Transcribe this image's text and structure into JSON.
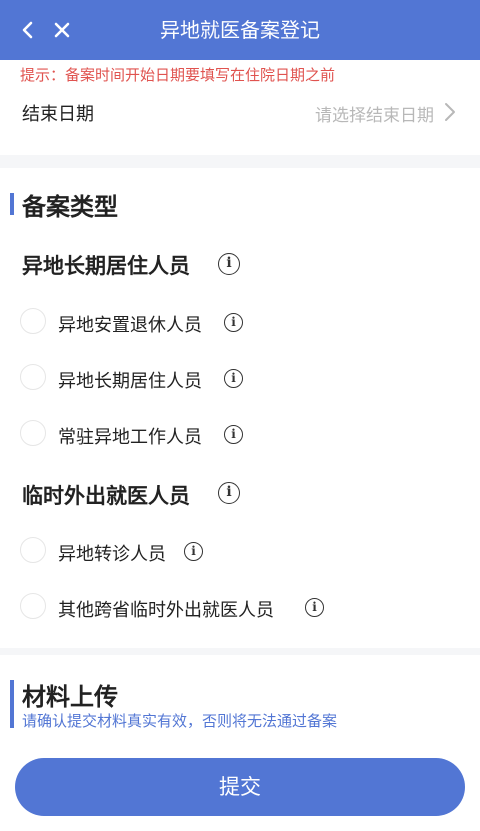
{
  "header": {
    "title": "异地就医备案登记"
  },
  "notice": {
    "tip": "提示：备案时间开始日期要填写在住院日期之前"
  },
  "end_date": {
    "label": "结束日期",
    "placeholder": "请选择结束日期"
  },
  "filing_type": {
    "title": "备案类型",
    "groups": [
      {
        "title": "异地长期居住人员",
        "options": [
          "异地安置退休人员",
          "异地长期居住人员",
          "常驻异地工作人员"
        ]
      },
      {
        "title": "临时外出就医人员",
        "options": [
          "异地转诊人员",
          "其他跨省临时外出就医人员"
        ]
      }
    ]
  },
  "materials": {
    "title": "材料上传",
    "subtitle": "请确认提交材料真实有效，否则将无法通过备案"
  },
  "submit_label": "提交",
  "colors": {
    "primary": "#5276d4",
    "warning": "#e0534f",
    "placeholder": "#b8b8b8"
  }
}
